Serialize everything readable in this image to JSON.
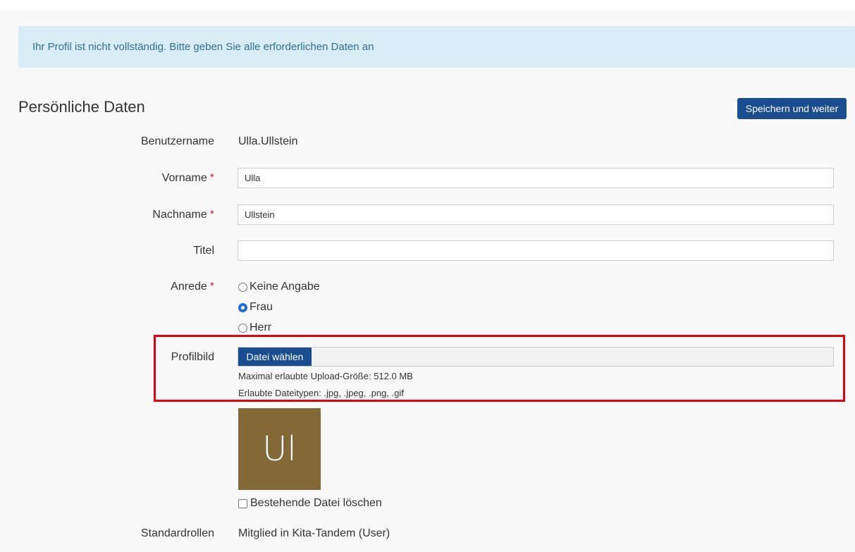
{
  "alert": {
    "message": "Ihr Profil ist nicht vollständig. Bitte geben Sie alle erforderlichen Daten an"
  },
  "section": {
    "title": "Persönliche Daten",
    "save_button": "Speichern und weiter"
  },
  "form": {
    "username": {
      "label": "Benutzername",
      "value": "Ulla.Ullstein"
    },
    "firstname": {
      "label": "Vorname",
      "required_mark": "*",
      "value": "Ulla"
    },
    "lastname": {
      "label": "Nachname",
      "required_mark": "*",
      "value": "Ullstein"
    },
    "title": {
      "label": "Titel",
      "value": ""
    },
    "salutation": {
      "label": "Anrede",
      "required_mark": "*",
      "options": [
        {
          "label": "Keine Angabe",
          "checked": false
        },
        {
          "label": "Frau",
          "checked": true
        },
        {
          "label": "Herr",
          "checked": false
        }
      ]
    },
    "profile_image": {
      "label": "Profilbild",
      "choose_button": "Datei wählen",
      "max_size_text": "Maximal erlaubte Upload-Größe: 512.0 MB",
      "file_types_text": "Erlaubte Dateitypen: .jpg, .jpeg, .png, .gif",
      "avatar_initials": "Ul",
      "avatar_color": "#836838",
      "delete_label": "Bestehende Datei löschen"
    },
    "default_roles": {
      "label": "Standardrollen",
      "value": "Mitglied in Kita-Tandem (User)"
    }
  },
  "colors": {
    "primary": "#1a4d8f",
    "alert_bg": "#d9edf7",
    "alert_text": "#31708f",
    "required": "#c9302c",
    "highlight": "#e3000f"
  }
}
